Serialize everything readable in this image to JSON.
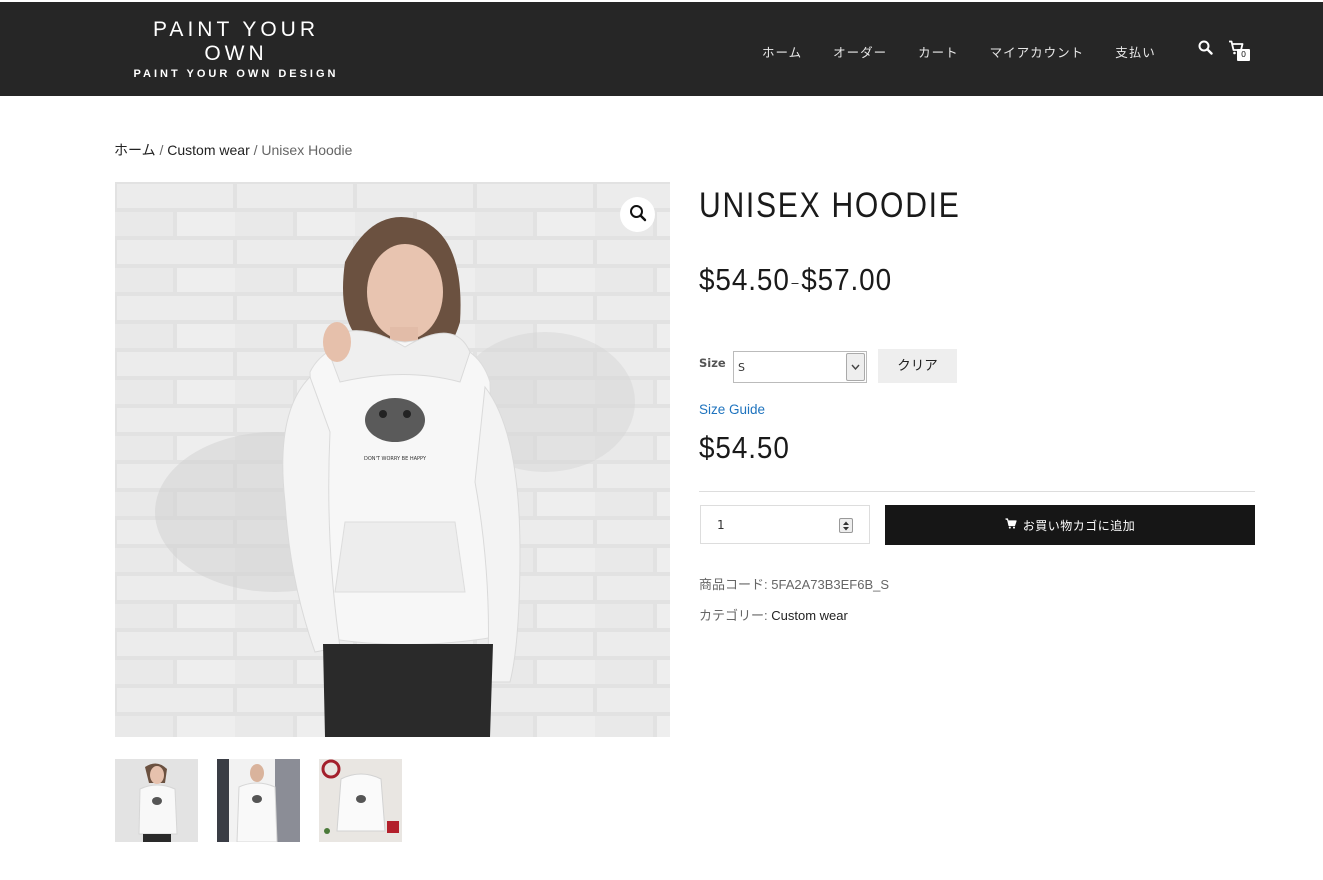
{
  "header": {
    "logo_title": "PAINT YOUR OWN",
    "logo_subtitle": "PAINT YOUR OWN DESIGN",
    "nav": [
      "ホーム",
      "オーダー",
      "カート",
      "マイアカウント",
      "支払い"
    ],
    "cart_count": "0",
    "icons": [
      "search-icon",
      "cart-icon"
    ]
  },
  "breadcrumb": {
    "home": "ホーム",
    "category": "Custom wear",
    "sep": "/",
    "current": "Unisex Hoodie"
  },
  "product": {
    "title": "UNISEX HOODIE",
    "price_min": "$54.50",
    "price_sep": "–",
    "price_max": "$57.00",
    "size_label": "Size",
    "size_value": "S",
    "clear_label": "クリア",
    "size_guide_label": "Size Guide",
    "variation_price": "$54.50",
    "quantity": "1",
    "add_to_cart_label": "お買い物カゴに追加",
    "sku_label": "商品コード:",
    "sku_value": "5FA2A73B3EF6B_S",
    "category_label": "カテゴリー:",
    "category_value": "Custom wear",
    "print_text": "DON'T WORRY BE HAPPY"
  },
  "colors": {
    "header_bg": "#262626",
    "button_bg": "#161616",
    "link_blue": "#1e73be"
  }
}
